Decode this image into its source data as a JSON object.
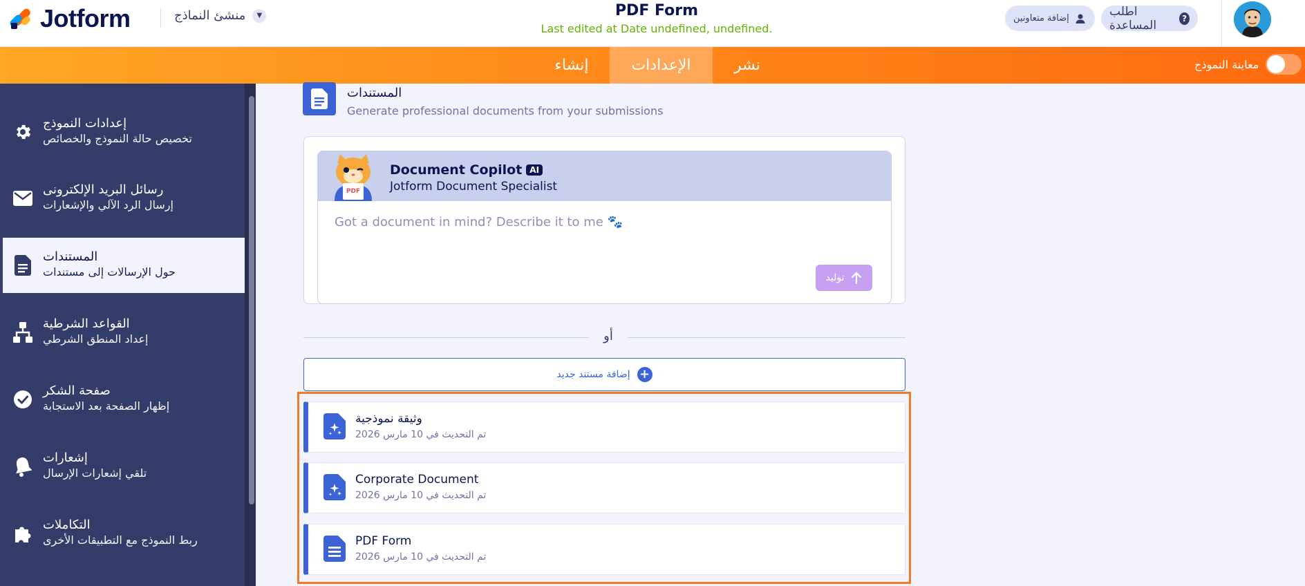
{
  "header": {
    "logo_text": "Jotform",
    "builder_label": "منشئ النماذج",
    "form_title": "PDF Form",
    "last_edited": "Last edited at Date undefined, undefined.",
    "help_label": "اطلب المساعدة",
    "collab_label": "إضافة متعاونين"
  },
  "nav": {
    "tabs": [
      {
        "label": "إنشاء",
        "active": false
      },
      {
        "label": "الإعدادات",
        "active": true
      },
      {
        "label": "نشر",
        "active": false
      }
    ],
    "preview_label": "معاينة النموذج",
    "preview_on": false
  },
  "sidebar": {
    "items": [
      {
        "icon": "gear-icon",
        "title": "إعدادات النموذج",
        "subtitle": "تخصيص حالة النموذج والخصائص",
        "active": false
      },
      {
        "icon": "envelope-icon",
        "title": "رسائل البريد الإلكترونى",
        "subtitle": "إرسال الرد الآلي والإشعارات",
        "active": false
      },
      {
        "icon": "document-icon",
        "title": "المستندات",
        "subtitle": "حول الإرسالات إلى مستندات",
        "active": true
      },
      {
        "icon": "conditions-icon",
        "title": "القواعد الشرطية",
        "subtitle": "إعداد المنطق الشرطي",
        "active": false
      },
      {
        "icon": "check-circle-icon",
        "title": "صفحة الشكر",
        "subtitle": "إظهار الصفحة بعد الاستجابة",
        "active": false
      },
      {
        "icon": "bell-icon",
        "title": "إشعارات",
        "subtitle": "تلقي إشعارات الإرسال",
        "active": false
      },
      {
        "icon": "puzzle-icon",
        "title": "التكاملات",
        "subtitle": "ربط النموذج مع التطبيقات الأخرى",
        "active": false
      }
    ]
  },
  "section": {
    "title": "المستندات",
    "subtitle": "Generate professional documents from your submissions"
  },
  "copilot": {
    "title": "Document Copilot",
    "badge": "AI",
    "subtitle": "Jotform Document Specialist",
    "placeholder": "Got a document in mind? Describe it to me 🐾",
    "send_label": "توليد",
    "mascot_label": "PDF"
  },
  "or_label": "أو",
  "add_document_label": "إضافة مستند جديد",
  "documents": [
    {
      "name": "وثيقة نموذجية",
      "updated": "تم التحديث في 10 مارس 2026",
      "icon": "sparkle-doc-icon"
    },
    {
      "name": "Corporate Document",
      "updated": "تم التحديث في 10 مارس 2026",
      "icon": "sparkle-doc-icon"
    },
    {
      "name": "PDF Form",
      "updated": "تم التحديث في 10 مارس 2026",
      "icon": "lines-doc-icon"
    }
  ],
  "colors": {
    "brand_dark": "#0a1551",
    "accent_blue": "#3b63d6",
    "nav_orange": "#ff8c1a",
    "sidebar_bg": "#343c6a",
    "highlight_frame": "#f27a24",
    "last_edited_green": "#64b200"
  }
}
